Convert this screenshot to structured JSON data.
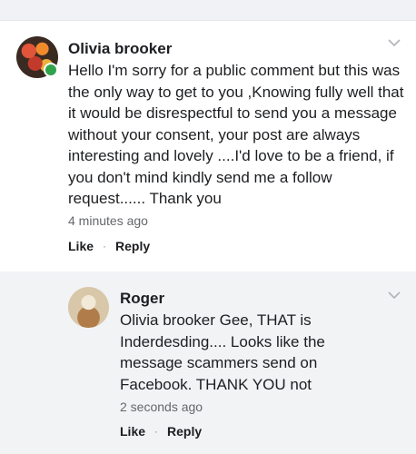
{
  "comments": [
    {
      "author": "Olivia brooker",
      "text": "Hello I'm sorry for a public comment but this was the only way to get to you ,Knowing fully well that it would be disrespectful to send you a message without your consent, your post are always interesting and lovely ....I'd love to be a friend, if you don't mind kindly send me a follow request...... Thank you",
      "time": "4 minutes ago",
      "like_label": "Like",
      "reply_label": "Reply",
      "separator": "·",
      "online": true
    },
    {
      "author": "Roger",
      "text": "Olivia brooker Gee, THAT is Inderdesding.... Looks like the message scammers send on Facebook. THANK YOU not",
      "time": "2 seconds ago",
      "like_label": "Like",
      "reply_label": "Reply",
      "separator": "·",
      "online": false
    }
  ],
  "colors": {
    "online_dot": "#31a24c",
    "reply_background": "#f2f3f5",
    "secondary_text": "#65676b"
  },
  "icons": {
    "menu": "chevron-down-icon"
  }
}
